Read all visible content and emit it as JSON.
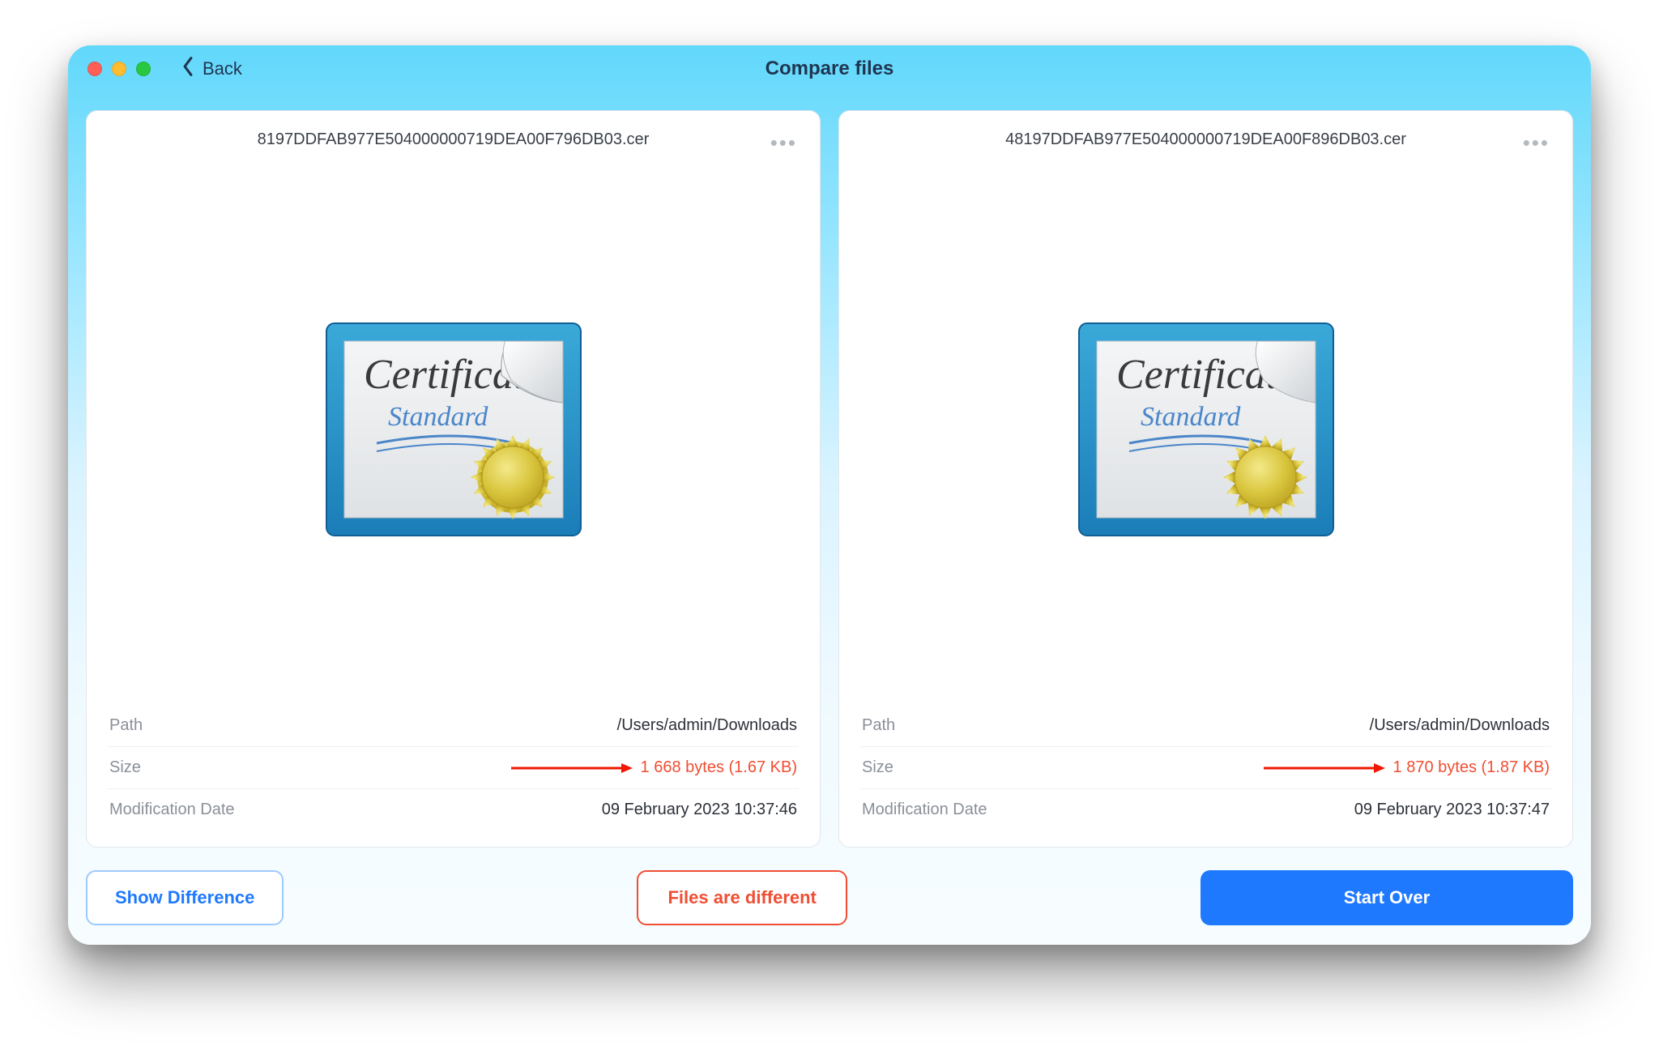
{
  "window": {
    "title": "Compare files",
    "back_label": "Back"
  },
  "labels": {
    "path": "Path",
    "size": "Size",
    "modified": "Modification Date"
  },
  "files": {
    "left": {
      "name": "8197DDFAB977E504000000719DEA00F796DB03.cer",
      "path": "/Users/admin/Downloads",
      "size": "1 668 bytes (1.67 KB)",
      "modified": "09 February 2023 10:37:46",
      "icon_title": "Certificate",
      "icon_subtitle": "Standard"
    },
    "right": {
      "name": "48197DDFAB977E504000000719DEA00F896DB03.cer",
      "path": "/Users/admin/Downloads",
      "size": "1 870 bytes (1.87 KB)",
      "modified": "09 February 2023 10:37:47",
      "icon_title": "Certificate",
      "icon_subtitle": "Standard"
    }
  },
  "actions": {
    "show_diff": "Show Difference",
    "status": "Files are different",
    "start_over": "Start Over"
  },
  "colors": {
    "accent_blue": "#1f79ff",
    "accent_red": "#f04e33"
  }
}
